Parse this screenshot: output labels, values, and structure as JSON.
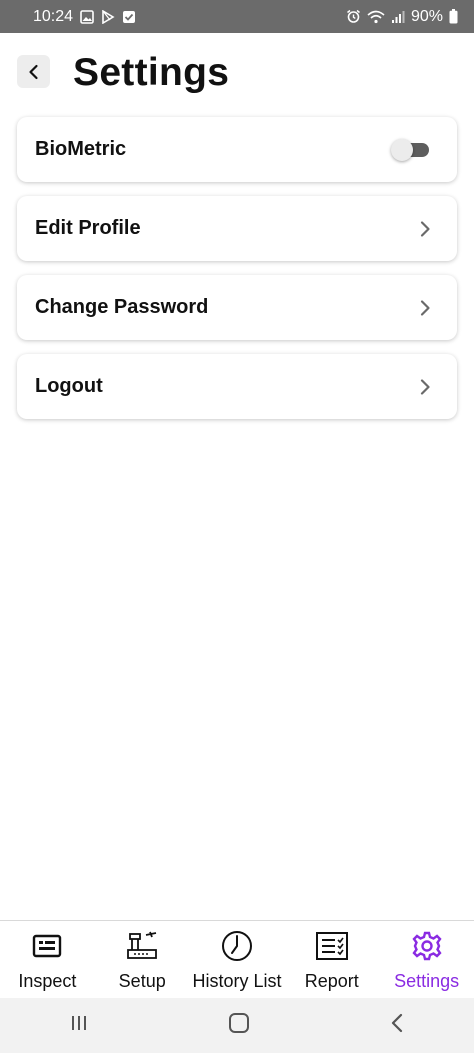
{
  "status_bar": {
    "time": "10:24",
    "battery": "90%"
  },
  "header": {
    "title": "Settings"
  },
  "settings": {
    "items": [
      {
        "label": "BioMetric"
      },
      {
        "label": "Edit Profile"
      },
      {
        "label": "Change Password"
      },
      {
        "label": "Logout"
      }
    ],
    "biometric_enabled": false
  },
  "bottom_nav": {
    "items": [
      {
        "label": "Inspect",
        "icon": "id-card-icon"
      },
      {
        "label": "Setup",
        "icon": "airport-tower-icon"
      },
      {
        "label": "History List",
        "icon": "clock-icon"
      },
      {
        "label": "Report",
        "icon": "checklist-icon"
      },
      {
        "label": "Settings",
        "icon": "gear-icon"
      }
    ],
    "active": "Settings",
    "active_color": "#8a2be2"
  }
}
